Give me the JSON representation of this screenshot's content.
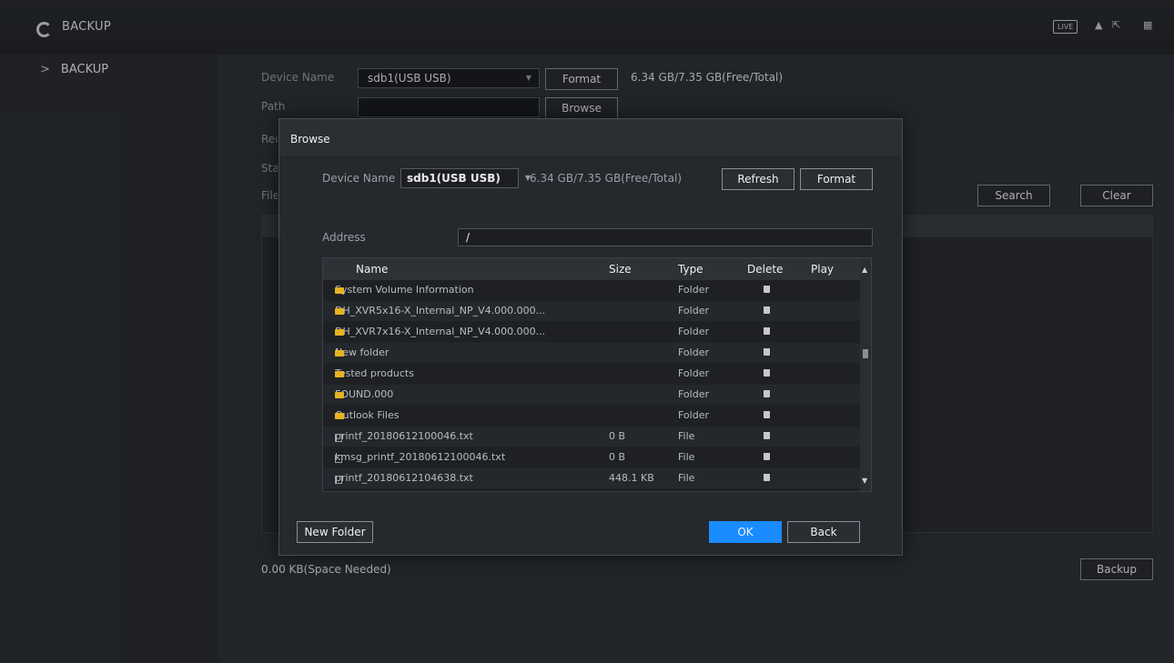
{
  "app": {
    "title": "BACKUP",
    "live_badge": "LIVE"
  },
  "sidebar": {
    "items": [
      {
        "label": "BACKUP"
      }
    ]
  },
  "form": {
    "device_label": "Device Name",
    "device_value": "sdb1(USB USB)",
    "format_button": "Format",
    "capacity": "6.34 GB/7.35 GB(Free/Total)",
    "path_label": "Path",
    "path_value": "",
    "browse_button": "Browse",
    "row3_label": "Rec",
    "row4_label": "Sta",
    "row5_label": "File",
    "search_button": "Search",
    "clear_button": "Clear",
    "space_needed": "0.00 KB(Space Needed)",
    "backup_button": "Backup"
  },
  "dialog": {
    "title": "Browse",
    "device_label": "Device Name",
    "device_value": "sdb1(USB USB)",
    "capacity": "6.34 GB/7.35 GB(Free/Total)",
    "refresh_button": "Refresh",
    "format_button": "Format",
    "address_label": "Address",
    "address_value": "/",
    "columns": {
      "name": "Name",
      "size": "Size",
      "type": "Type",
      "delete": "Delete",
      "play": "Play"
    },
    "rows": [
      {
        "name": "System Volume Information",
        "size": "",
        "type": "Folder",
        "kind": "folder"
      },
      {
        "name": "DH_XVR5x16-X_Internal_NP_V4.000.000...",
        "size": "",
        "type": "Folder",
        "kind": "folder"
      },
      {
        "name": "DH_XVR7x16-X_Internal_NP_V4.000.000...",
        "size": "",
        "type": "Folder",
        "kind": "folder"
      },
      {
        "name": "New folder",
        "size": "",
        "type": "Folder",
        "kind": "folder"
      },
      {
        "name": "Tested products",
        "size": "",
        "type": "Folder",
        "kind": "folder"
      },
      {
        "name": "FOUND.000",
        "size": "",
        "type": "Folder",
        "kind": "folder"
      },
      {
        "name": "Outlook Files",
        "size": "",
        "type": "Folder",
        "kind": "folder"
      },
      {
        "name": "printf_20180612100046.txt",
        "size": "0 B",
        "type": "File",
        "kind": "file"
      },
      {
        "name": "kmsg_printf_20180612100046.txt",
        "size": "0 B",
        "type": "File",
        "kind": "file"
      },
      {
        "name": "printf_20180612104638.txt",
        "size": "448.1 KB",
        "type": "File",
        "kind": "file"
      }
    ],
    "new_folder_button": "New Folder",
    "ok_button": "OK",
    "back_button": "Back"
  },
  "colors": {
    "accent": "#1a8cff",
    "folder": "#e6b422"
  }
}
